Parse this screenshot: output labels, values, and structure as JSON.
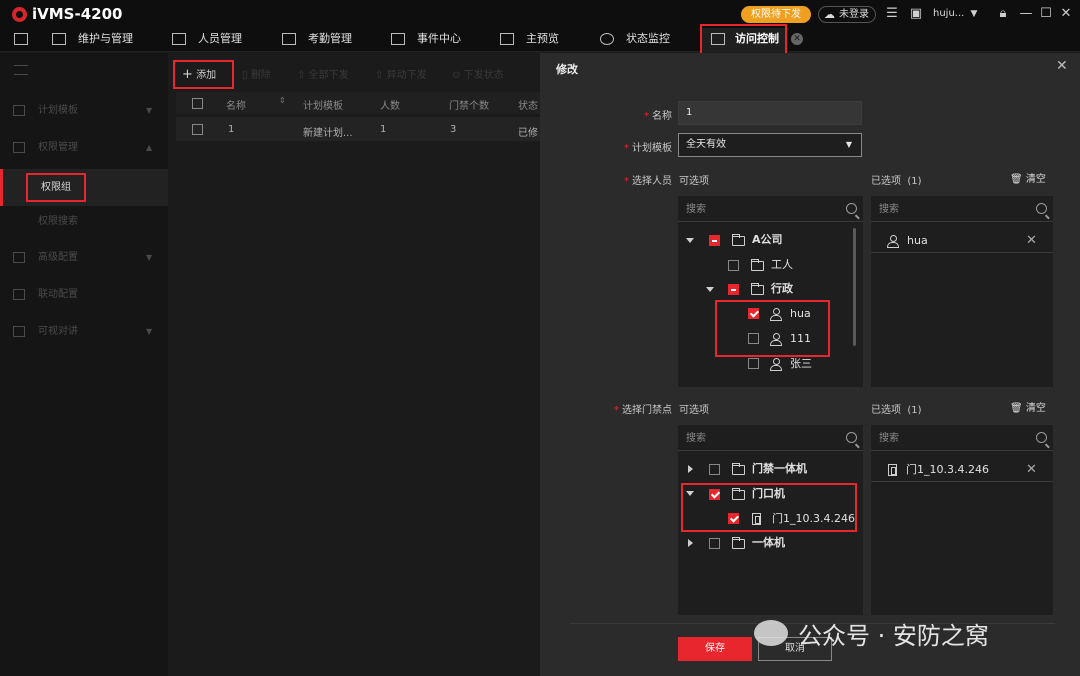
{
  "app": {
    "title": "iVMS-4200",
    "status_pill": "权限待下发",
    "login": "未登录",
    "user": "huju...",
    "colors": {
      "accent": "#e8262e",
      "pill": "#f0a020"
    }
  },
  "tabs": [
    {
      "label": "维护与管理",
      "icon": "maintenance-icon"
    },
    {
      "label": "人员管理",
      "icon": "person-card-icon"
    },
    {
      "label": "考勤管理",
      "icon": "calendar-icon"
    },
    {
      "label": "事件中心",
      "icon": "alarm-icon"
    },
    {
      "label": "主预览",
      "icon": "monitor-icon"
    },
    {
      "label": "状态监控",
      "icon": "status-icon"
    },
    {
      "label": "访问控制",
      "icon": "door-icon"
    }
  ],
  "sidebar": {
    "items": [
      {
        "label": "计划模板"
      },
      {
        "label": "权限管理"
      },
      {
        "label": "权限组"
      },
      {
        "label": "权限搜索"
      },
      {
        "label": "高级配置"
      },
      {
        "label": "联动配置"
      },
      {
        "label": "可视对讲"
      }
    ]
  },
  "toolbar": {
    "add": "添加",
    "delete": "删除",
    "all_send": "全部下发",
    "changed_send": "异动下发",
    "send_status": "下发状态"
  },
  "table": {
    "headers": [
      "名称",
      "计划模板",
      "人数",
      "门禁个数",
      "状态"
    ],
    "rows": [
      [
        "1",
        "新建计划...",
        "1",
        "3",
        "已修"
      ]
    ]
  },
  "dialog": {
    "title": "修改",
    "name_label": "名称",
    "name_value": "1",
    "plan_label": "计划模板",
    "plan_value": "全天有效",
    "person_label": "选择人员",
    "door_label": "选择门禁点",
    "available": "可选项",
    "selected": "已选项",
    "selected_count_person": "(1)",
    "selected_count_door": "(1)",
    "clear": "清空",
    "search_placeholder": "搜索",
    "person_tree": [
      {
        "label": "A公司"
      },
      {
        "label": "工人"
      },
      {
        "label": "行政"
      },
      {
        "label": "hua"
      },
      {
        "label": "111"
      },
      {
        "label": "张三"
      }
    ],
    "selected_person": "hua",
    "door_tree": [
      {
        "label": "门禁一体机"
      },
      {
        "label": "门口机"
      },
      {
        "label": "门1_10.3.4.246"
      },
      {
        "label": "一体机"
      }
    ],
    "selected_door": "门1_10.3.4.246",
    "save": "保存",
    "cancel": "取消"
  },
  "watermark": "公众号 · 安防之窝"
}
